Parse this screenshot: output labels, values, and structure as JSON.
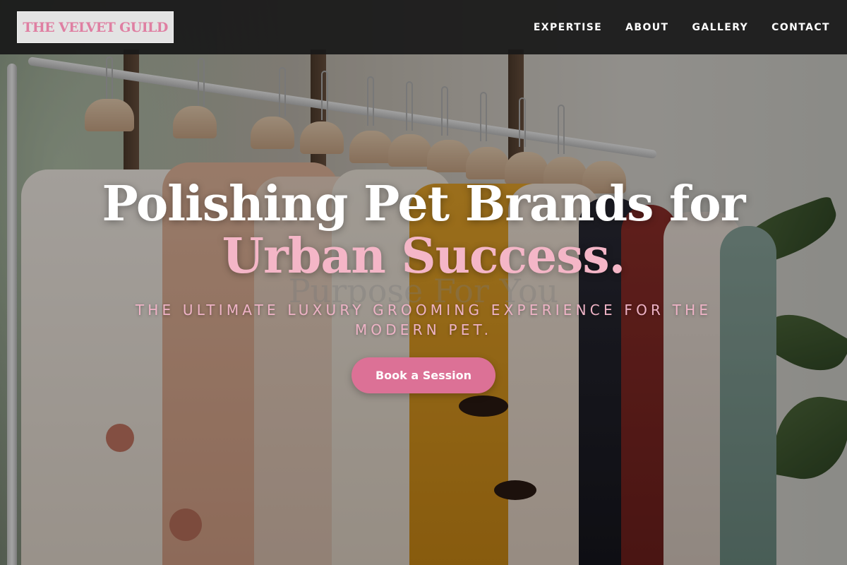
{
  "brand": {
    "logo_text": "THE VELVET GUILD",
    "accent_color": "#df7fa2"
  },
  "nav": {
    "items": [
      {
        "label": "EXPERTISE"
      },
      {
        "label": "ABOUT"
      },
      {
        "label": "GALLERY"
      },
      {
        "label": "CONTACT"
      }
    ]
  },
  "hero": {
    "headline_line1": "Polishing Pet Brands for",
    "headline_line2": "Urban Success.",
    "ghost_text": "Purpose For You",
    "subheadline": "THE ULTIMATE LUXURY GROOMING EXPERIENCE FOR THE MODERN PET.",
    "cta_label": "Book a Session",
    "cta_color": "#dc7196",
    "headline_accent_color": "#f4b6c7",
    "background_image": "clothing-rack-photo"
  }
}
